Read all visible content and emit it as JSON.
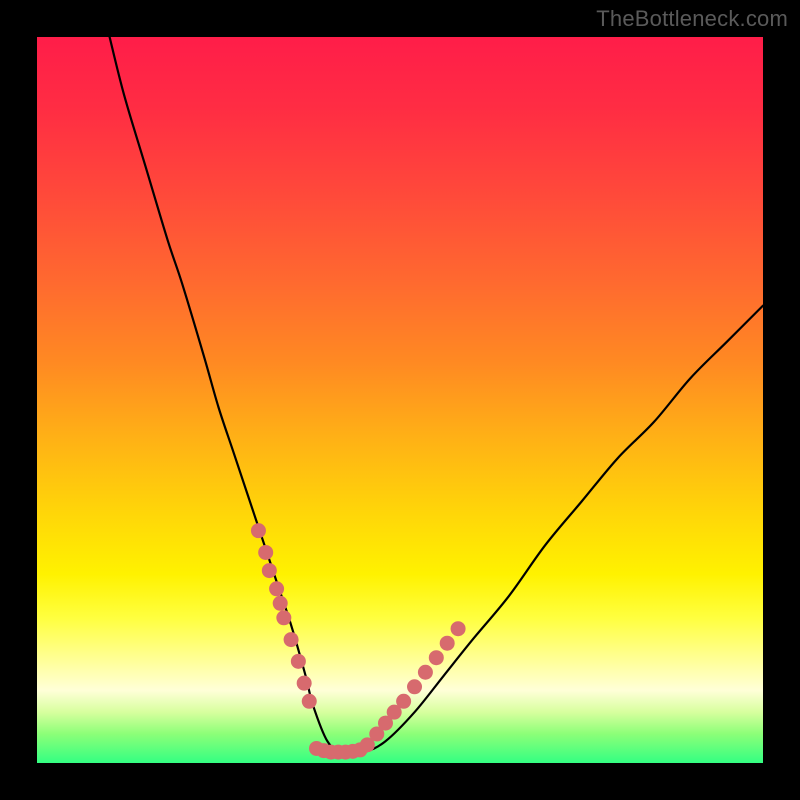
{
  "watermark": "TheBottleneck.com",
  "chart_data": {
    "type": "line",
    "title": "",
    "xlabel": "",
    "ylabel": "",
    "x_range": [
      0,
      100
    ],
    "y_range": [
      0,
      100
    ],
    "series": [
      {
        "name": "bottleneck-curve",
        "x": [
          10,
          12,
          15,
          18,
          20,
          23,
          25,
          27,
          29,
          31,
          33,
          35,
          37,
          38,
          40,
          42,
          45,
          48,
          52,
          56,
          60,
          65,
          70,
          75,
          80,
          85,
          90,
          95,
          100
        ],
        "y": [
          100,
          92,
          82,
          72,
          66,
          56,
          49,
          43,
          37,
          31,
          25,
          19,
          12,
          8,
          3,
          1.5,
          1.5,
          3,
          7,
          12,
          17,
          23,
          30,
          36,
          42,
          47,
          53,
          58,
          63
        ]
      }
    ],
    "scatter": [
      {
        "name": "marker-cluster-left",
        "color": "#d76a6e",
        "points": [
          {
            "x": 30.5,
            "y": 32
          },
          {
            "x": 31.5,
            "y": 29
          },
          {
            "x": 32.0,
            "y": 26.5
          },
          {
            "x": 33.0,
            "y": 24
          },
          {
            "x": 33.5,
            "y": 22
          },
          {
            "x": 34.0,
            "y": 20
          },
          {
            "x": 35.0,
            "y": 17
          },
          {
            "x": 36.0,
            "y": 14
          },
          {
            "x": 36.8,
            "y": 11
          },
          {
            "x": 37.5,
            "y": 8.5
          }
        ]
      },
      {
        "name": "marker-floor",
        "color": "#d76a6e",
        "points": [
          {
            "x": 38.5,
            "y": 2.0
          },
          {
            "x": 39.5,
            "y": 1.7
          },
          {
            "x": 40.5,
            "y": 1.5
          },
          {
            "x": 41.5,
            "y": 1.5
          },
          {
            "x": 42.5,
            "y": 1.5
          },
          {
            "x": 43.5,
            "y": 1.6
          },
          {
            "x": 44.5,
            "y": 1.8
          }
        ]
      },
      {
        "name": "marker-cluster-right",
        "color": "#d76a6e",
        "points": [
          {
            "x": 45.5,
            "y": 2.5
          },
          {
            "x": 46.8,
            "y": 4.0
          },
          {
            "x": 48.0,
            "y": 5.5
          },
          {
            "x": 49.2,
            "y": 7.0
          },
          {
            "x": 50.5,
            "y": 8.5
          },
          {
            "x": 52.0,
            "y": 10.5
          },
          {
            "x": 53.5,
            "y": 12.5
          },
          {
            "x": 55.0,
            "y": 14.5
          },
          {
            "x": 56.5,
            "y": 16.5
          },
          {
            "x": 58.0,
            "y": 18.5
          }
        ]
      }
    ],
    "gradient_stops": [
      {
        "pos": 0,
        "color": "#ff1d49"
      },
      {
        "pos": 50,
        "color": "#ffb016"
      },
      {
        "pos": 80,
        "color": "#ffff3f"
      },
      {
        "pos": 100,
        "color": "#33ff82"
      }
    ]
  }
}
